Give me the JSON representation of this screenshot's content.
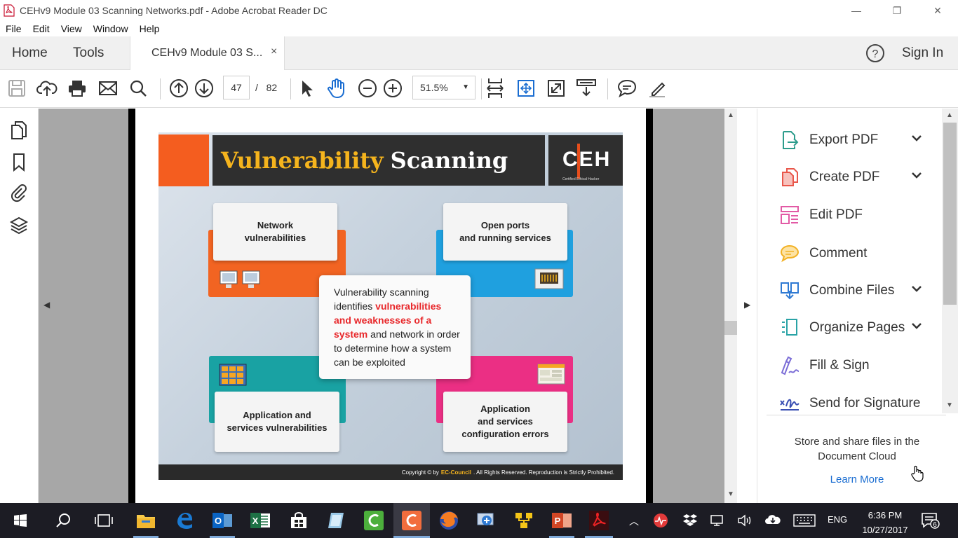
{
  "window": {
    "title": "CEHv9 Module 03 Scanning Networks.pdf - Adobe Acrobat Reader DC",
    "minimize": "—",
    "maximize": "❐",
    "close": "✕"
  },
  "menu": [
    "File",
    "Edit",
    "View",
    "Window",
    "Help"
  ],
  "tabs": {
    "home": "Home",
    "tools": "Tools",
    "document": "CEHv9 Module 03 S...",
    "document_close": "×",
    "help": "?",
    "sign_in": "Sign In"
  },
  "toolbar": {
    "page_current": "47",
    "page_separator": "/",
    "page_total": "82",
    "zoom": "51.5%",
    "zoom_arrow": "▼"
  },
  "slide": {
    "title_highlight": "Vulnerability",
    "title_rest": "Scanning",
    "logo_text": "CEH",
    "logo_small": "Certified  Ethical  Hacker",
    "card_network": [
      "Network",
      "vulnerabilities"
    ],
    "card_ports": [
      "Open ports",
      "and running services"
    ],
    "card_app": [
      "Application and",
      "services vulnerabilities"
    ],
    "card_config": [
      "Application",
      "and services",
      "configuration errors"
    ],
    "center_text_1": "Vulnerability scanning identifies",
    "center_red": "vulnerabilities and weaknesses of a system",
    "center_text_2": "and network in order to determine how a system can be exploited",
    "footer_pre": "Copyright © by",
    "footer_brand": "EC-Council",
    "footer_post": ". All Rights Reserved. Reproduction is Strictly Prohibited."
  },
  "right_panel": {
    "tools": [
      {
        "label": "Export PDF",
        "icon": "export-pdf-icon",
        "color": "#2d9c8c",
        "has_chevron": true
      },
      {
        "label": "Create PDF",
        "icon": "create-pdf-icon",
        "color": "#e9574b",
        "has_chevron": true
      },
      {
        "label": "Edit PDF",
        "icon": "edit-pdf-icon",
        "color": "#e25aa5",
        "has_chevron": false
      },
      {
        "label": "Comment",
        "icon": "comment-icon",
        "color": "#f2b124",
        "has_chevron": false
      },
      {
        "label": "Combine Files",
        "icon": "combine-files-icon",
        "color": "#2f7ad3",
        "has_chevron": true
      },
      {
        "label": "Organize Pages",
        "icon": "organize-pages-icon",
        "color": "#2aa3a6",
        "has_chevron": true
      },
      {
        "label": "Fill & Sign",
        "icon": "fill-sign-icon",
        "color": "#7a6cd6",
        "has_chevron": false
      },
      {
        "label": "Send for Signature",
        "icon": "send-signature-icon",
        "color": "#3a4fb3",
        "has_chevron": false
      }
    ],
    "cloud_text": "Store and share files in the Document Cloud",
    "learn_more": "Learn More"
  },
  "taskbar": {
    "language": "ENG",
    "time": "6:36 PM",
    "date": "10/27/2017",
    "notifications": "6"
  }
}
